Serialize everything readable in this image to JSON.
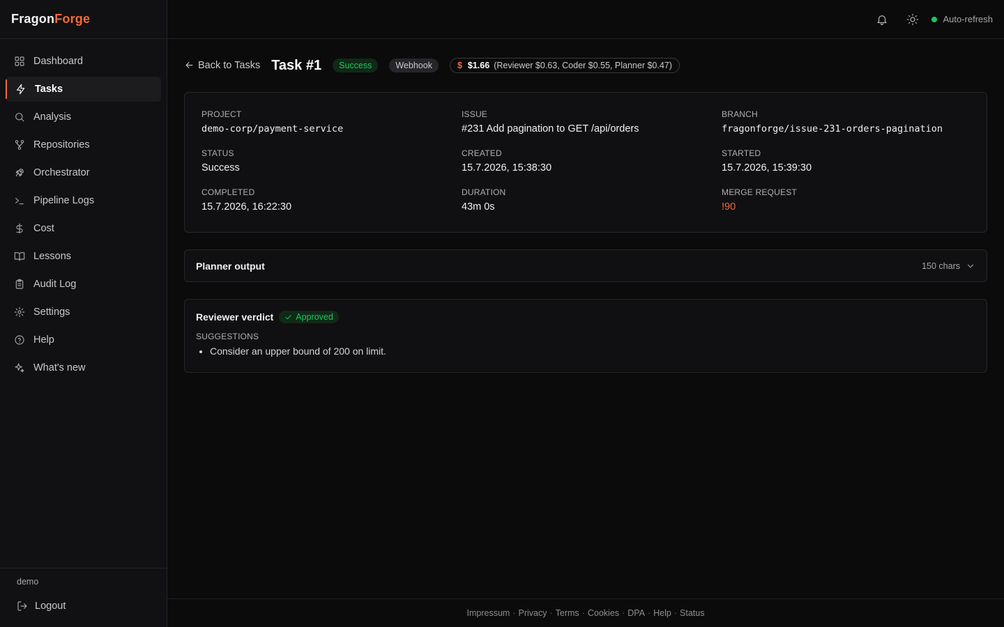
{
  "brand": {
    "part1": "Fragon",
    "part2": "Forge"
  },
  "sidebar": {
    "items": [
      {
        "label": "Dashboard",
        "icon": "grid-icon"
      },
      {
        "label": "Tasks",
        "icon": "zap-icon"
      },
      {
        "label": "Analysis",
        "icon": "search-icon"
      },
      {
        "label": "Repositories",
        "icon": "git-branch-icon"
      },
      {
        "label": "Orchestrator",
        "icon": "rocket-icon"
      },
      {
        "label": "Pipeline Logs",
        "icon": "terminal-icon"
      },
      {
        "label": "Cost",
        "icon": "dollar-icon"
      },
      {
        "label": "Lessons",
        "icon": "book-open-icon"
      },
      {
        "label": "Audit Log",
        "icon": "clipboard-icon"
      },
      {
        "label": "Settings",
        "icon": "gear-icon"
      },
      {
        "label": "Help",
        "icon": "help-circle-icon"
      },
      {
        "label": "What's new",
        "icon": "sparkles-icon"
      }
    ],
    "active_index": 1,
    "user": "demo",
    "logout_label": "Logout"
  },
  "topbar": {
    "auto_refresh_label": "Auto-refresh",
    "status_color": "#22c55e"
  },
  "header": {
    "back_label": "Back to Tasks",
    "title": "Task #1",
    "status_badge": "Success",
    "trigger_badge": "Webhook",
    "cost_symbol": "$",
    "cost_total": "$1.66",
    "cost_breakdown": "(Reviewer $0.63, Coder $0.55, Planner $0.47)"
  },
  "info": {
    "project_label": "PROJECT",
    "project": "demo-corp/payment-service",
    "issue_label": "ISSUE",
    "issue": "#231 Add pagination to GET /api/orders",
    "branch_label": "BRANCH",
    "branch": "fragonforge/issue-231-orders-pagination",
    "status_label": "STATUS",
    "status": "Success",
    "created_label": "CREATED",
    "created": "15.7.2026, 15:38:30",
    "started_label": "STARTED",
    "started": "15.7.2026, 15:39:30",
    "completed_label": "COMPLETED",
    "completed": "15.7.2026, 16:22:30",
    "duration_label": "DURATION",
    "duration": "43m 0s",
    "mr_label": "MERGE REQUEST",
    "mr": "!90"
  },
  "planner": {
    "title": "Planner output",
    "chars": "150 chars"
  },
  "verdict": {
    "title": "Reviewer verdict",
    "badge": "Approved",
    "suggestions_label": "SUGGESTIONS",
    "suggestions": [
      "Consider an upper bound of 200 on limit."
    ]
  },
  "footer": {
    "links": [
      "Impressum",
      "Privacy",
      "Terms",
      "Cookies",
      "DPA",
      "Help",
      "Status"
    ],
    "separator": "·"
  },
  "colors": {
    "accent": "#f26b3a",
    "success": "#22c55e",
    "background": "#0b0b0c"
  }
}
